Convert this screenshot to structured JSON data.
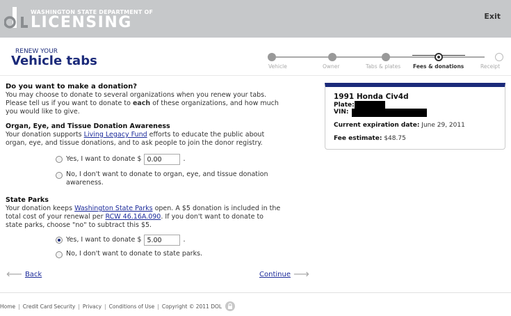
{
  "header": {
    "org_small": "WASHINGTON STATE DEPARTMENT OF",
    "org_big": "LICENSING",
    "exit_label": "Exit"
  },
  "title": {
    "small": "RENEW YOUR",
    "big": "Vehicle tabs"
  },
  "stepper": {
    "steps": [
      {
        "label": "Vehicle",
        "state": "done"
      },
      {
        "label": "Owner",
        "state": "done"
      },
      {
        "label": "Tabs & plates",
        "state": "done"
      },
      {
        "label": "Fees & donations",
        "state": "current"
      },
      {
        "label": "Receipt",
        "state": "future"
      }
    ]
  },
  "donation": {
    "question": "Do you want to make a donation?",
    "intro_1": "You may choose to donate to several organizations when you renew your tabs.",
    "intro_2a": "Please tell us if you want to donate to ",
    "intro_2b": "each",
    "intro_2c": " of these organizations, and how much",
    "intro_3": "you would like to give."
  },
  "organ": {
    "heading": "Organ, Eye, and Tissue Donation Awareness",
    "text_a": "Your donation supports ",
    "link": "Living Legacy Fund",
    "text_b": " efforts to educate the public about",
    "text_c": "organ, eye, and tissue donations, and to ask people to join the donor registry.",
    "yes_label": "Yes, I want to donate $",
    "yes_value": "0.00",
    "no_label_1": "No, I don't want to donate to organ, eye, and tissue donation",
    "no_label_2": "awareness.",
    "selected": "none"
  },
  "parks": {
    "heading": "State Parks",
    "text_a": "Your donation keeps ",
    "link": "Washington State Parks",
    "text_b": " open. A $5 donation is included in the",
    "text_c": "total cost of your renewal per ",
    "rcw_link": "RCW 46.16A.090",
    "text_d": ". If you don't want to donate to",
    "text_e": "state parks, choose \"no\" to subtract this $5.",
    "yes_label": "Yes, I want to donate $",
    "yes_value": "5.00",
    "no_label": "No, I don't want to donate to state parks.",
    "selected": "yes"
  },
  "nav": {
    "back_label": "Back",
    "continue_label": "Continue"
  },
  "vehicle_card": {
    "vehicle": "1991 Honda Civ4d",
    "plate_label": "Plate:",
    "vin_label": "VIN:",
    "exp_label": "Current expiration date:",
    "exp_value": "June 29, 2011",
    "fee_label": "Fee estimate:",
    "fee_value": "$48.75"
  },
  "footer": {
    "links": [
      "Home",
      "Credit Card Security",
      "Privacy",
      "Conditions of Use"
    ],
    "copyright": "Copyright © 2011 DOL"
  },
  "colors": {
    "brand": "#1b2a7a",
    "header_bg": "#c6c8ca",
    "link": "#1b2a9a"
  }
}
